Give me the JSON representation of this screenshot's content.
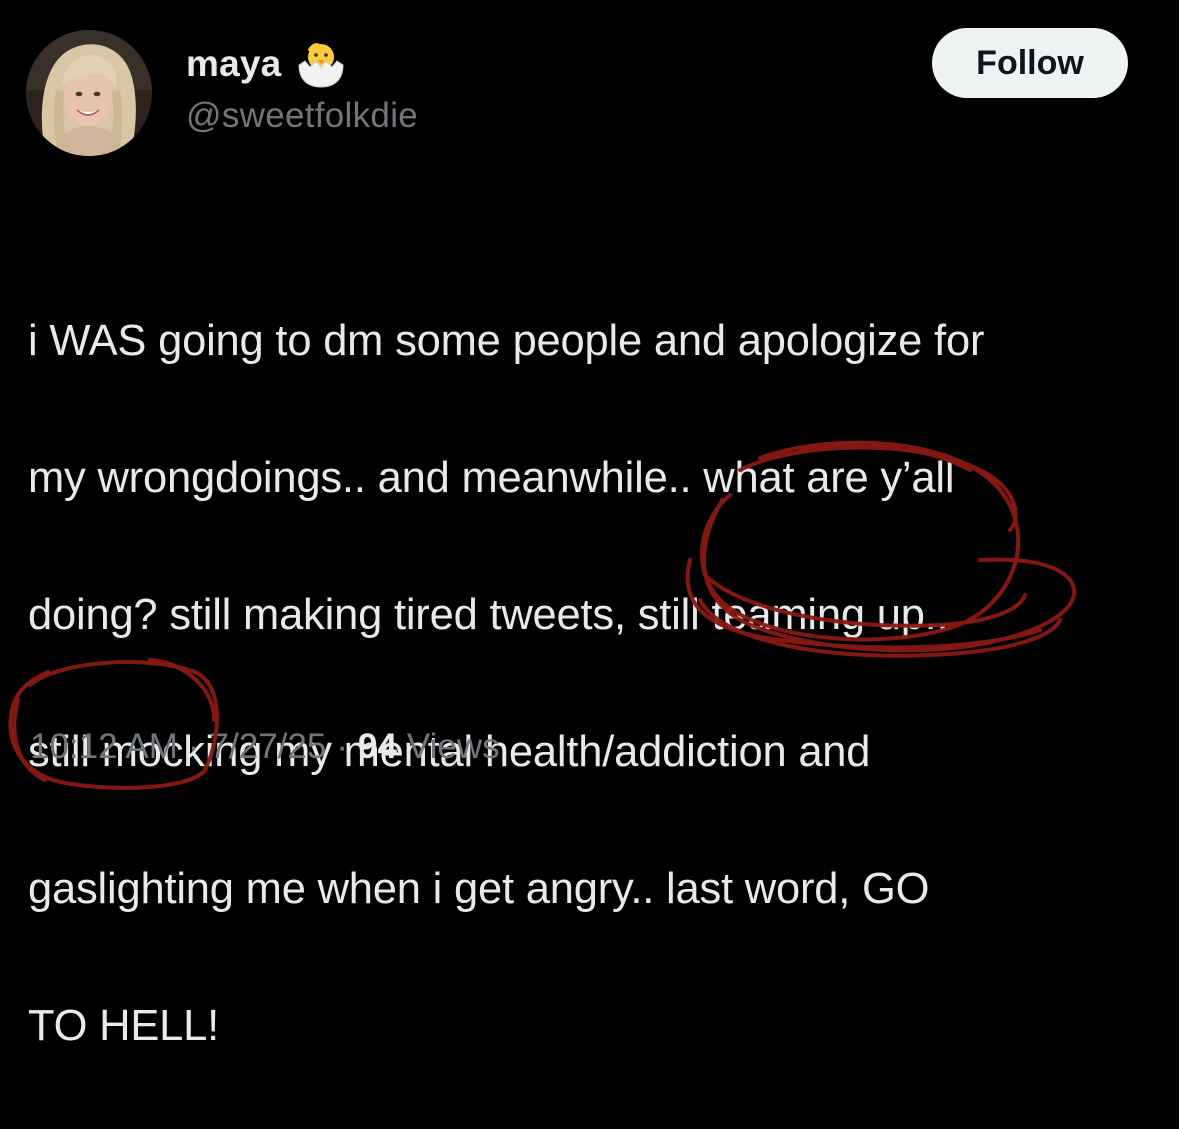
{
  "author": {
    "display_name": "maya",
    "handle": "@sweetfolkdie",
    "name_emoji": "hatching-chick-icon"
  },
  "actions": {
    "follow_label": "Follow"
  },
  "tweet": {
    "lines": [
      "i WAS going to dm some people and apologize for",
      "my wrongdoings.. and meanwhile.. what are y’all",
      "doing? still making tired tweets, still teaming up..",
      "still mocking my mental health/addiction and",
      "gaslighting me when i get angry.. last word, GO",
      "TO HELL!"
    ]
  },
  "meta": {
    "time": "10:12 AM",
    "separator": "·",
    "date": "7/27/25",
    "views_count": "94",
    "views_label": "Views"
  },
  "colors": {
    "background": "#000000",
    "text_primary": "#e7e9ea",
    "text_secondary": "#71767b",
    "follow_bg": "#eff3f4",
    "annotation_red": "#8b1a14"
  }
}
